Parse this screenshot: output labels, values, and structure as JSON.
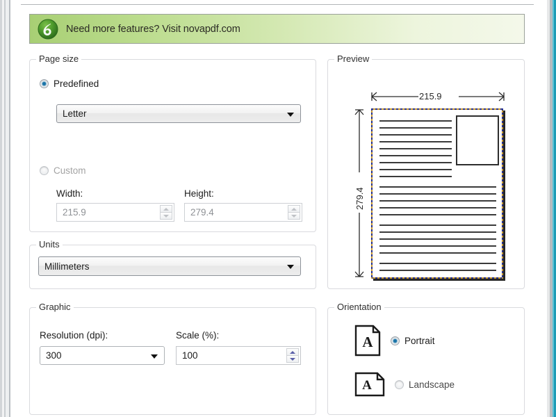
{
  "banner": {
    "text": "Need more features? Visit novapdf.com",
    "logo_icon": "novapdf-logo-icon",
    "bg_start": "#a8cf74",
    "bg_end": "#f4f8ea"
  },
  "page_size": {
    "title": "Page size",
    "predefined": {
      "label": "Predefined",
      "selected": true,
      "value": "Letter"
    },
    "custom": {
      "label": "Custom",
      "selected": false,
      "width_label": "Width:",
      "width_value": "215.9",
      "height_label": "Height:",
      "height_value": "279.4",
      "disabled": true
    }
  },
  "units": {
    "title": "Units",
    "value": "Millimeters"
  },
  "graphic": {
    "title": "Graphic",
    "resolution_label": "Resolution (dpi):",
    "resolution_value": "300",
    "scale_label": "Scale (%):",
    "scale_value": "100"
  },
  "preview": {
    "title": "Preview",
    "width_dim": "215.9",
    "height_dim": "279.4"
  },
  "orientation": {
    "title": "Orientation",
    "portrait": {
      "label": "Portrait",
      "selected": true,
      "icon": "page-portrait-icon",
      "glyph": "A"
    },
    "landscape": {
      "label": "Landscape",
      "selected": false,
      "icon": "page-landscape-icon",
      "glyph": "A"
    }
  },
  "theme": {
    "accent": "#1a74a8",
    "spinner_arrow": "#5a5fa8",
    "page_edge_blue": "#26308c",
    "page_edge_gold": "#c99a2e"
  }
}
